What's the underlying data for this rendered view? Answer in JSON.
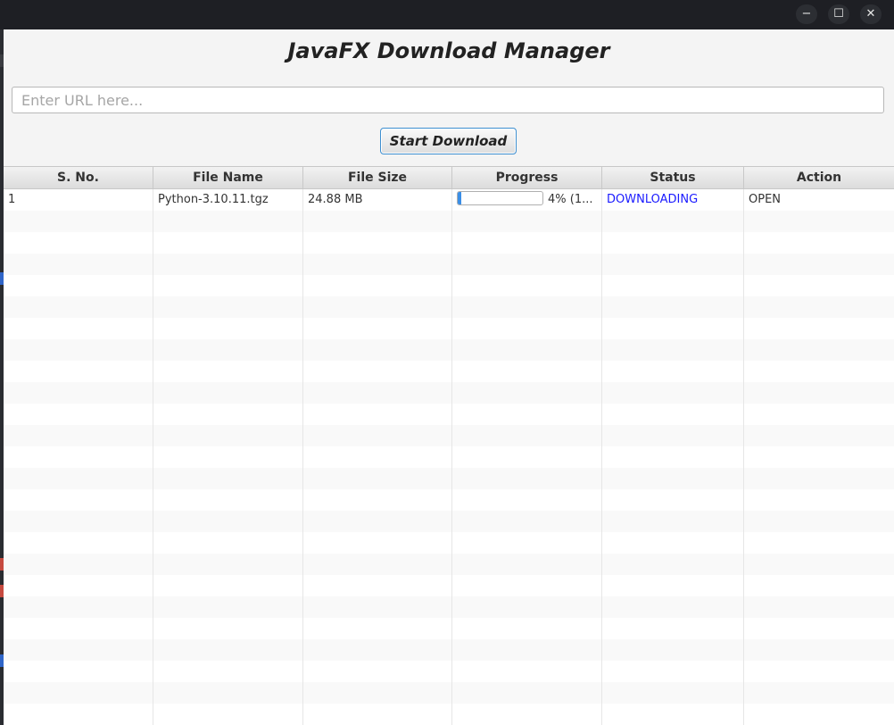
{
  "window": {
    "controls": {
      "minimize": "−",
      "maximize": "☐",
      "close": "✕"
    }
  },
  "app": {
    "title": "JavaFX Download Manager",
    "url_placeholder": "Enter URL here...",
    "url_value": "",
    "start_button": "Start Download"
  },
  "table": {
    "columns": [
      "S. No.",
      "File Name",
      "File Size",
      "Progress",
      "Status",
      "Action"
    ],
    "rows": [
      {
        "sno": "1",
        "file_name": "Python-3.10.11.tgz",
        "file_size": "24.88 MB",
        "progress_fraction": 0.04,
        "progress_text": "4% (1...",
        "status": "DOWNLOADING",
        "action": "OPEN"
      }
    ]
  },
  "colors": {
    "status_downloading": "#1a1aff",
    "progress_fill": "#3a8ee6",
    "button_focus": "#3e8fd0"
  }
}
